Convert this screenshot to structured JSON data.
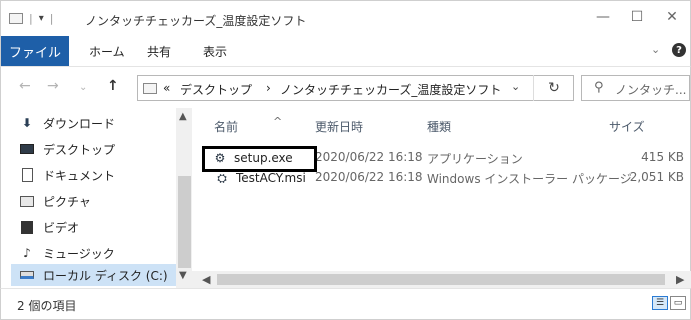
{
  "window": {
    "title": "ノンタッチチェッカーズ_温度設定ソフト",
    "minimize": "—",
    "maximize": "☐",
    "close": "✕"
  },
  "quick_access": {
    "separator": "|",
    "dropdown": "▾"
  },
  "ribbon": {
    "file_tab": "ファイル",
    "tabs": [
      "ホーム",
      "共有",
      "表示"
    ],
    "collapse_icon": "chevron-down-icon",
    "help": "?"
  },
  "address": {
    "overflow": "«",
    "crumbs": [
      "デスクトップ",
      "ノンタッチチェッカーズ_温度設定ソフト"
    ],
    "separator": "›",
    "dropdown": "⌄",
    "refresh": "↻"
  },
  "search": {
    "placeholder": "ノンタッチ..."
  },
  "nav_pane": {
    "items": [
      {
        "label": "ダウンロード",
        "icon": "download-icon"
      },
      {
        "label": "デスクトップ",
        "icon": "desktop-icon"
      },
      {
        "label": "ドキュメント",
        "icon": "document-icon"
      },
      {
        "label": "ピクチャ",
        "icon": "pictures-icon"
      },
      {
        "label": "ビデオ",
        "icon": "video-icon"
      },
      {
        "label": "ミュージック",
        "icon": "music-icon"
      },
      {
        "label": "ローカル ディスク (C:)",
        "icon": "local-disk-icon"
      }
    ]
  },
  "file_list": {
    "columns": [
      "名前",
      "更新日時",
      "種類",
      "サイズ"
    ],
    "rows": [
      {
        "name": "setup.exe",
        "modified": "2020/06/22 16:18",
        "type": "アプリケーション",
        "size": "415 KB",
        "icon": "setup-exe-icon"
      },
      {
        "name": "TestACY.msi",
        "modified": "2020/06/22 16:18",
        "type": "Windows インストーラー パッケージ",
        "size": "2,051 KB",
        "icon": "msi-package-icon"
      }
    ]
  },
  "status": {
    "count": "2 個の項目"
  }
}
